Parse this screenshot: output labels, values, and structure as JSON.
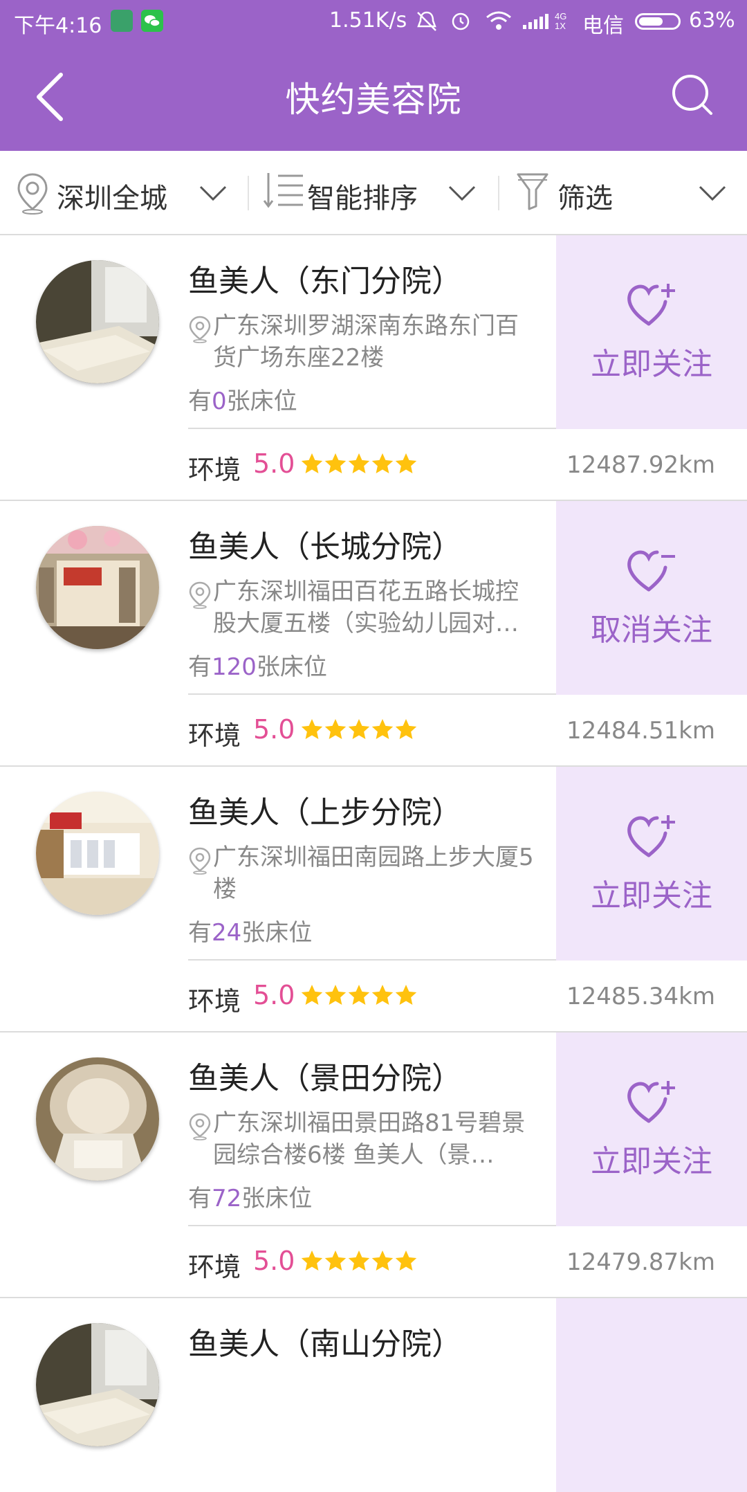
{
  "status_bar": {
    "time": "下午4:16",
    "net_speed": "1.51K/s",
    "carrier": "电信",
    "battery_pct": "63%",
    "battery_level": 0.63,
    "signal_label": "4G 1X"
  },
  "header": {
    "title": "快约美容院",
    "back_icon": "chevron-left-icon",
    "search_icon": "search-icon"
  },
  "filters": [
    {
      "label": "深圳全城",
      "icon": "location-pin-icon"
    },
    {
      "label": "智能排序",
      "icon": "sort-icon"
    },
    {
      "label": "筛选",
      "icon": "funnel-icon"
    }
  ],
  "colors": {
    "brand": "#9b63c8",
    "follow_bg": "#f1e6fa",
    "score": "#e34f95",
    "star": "#ffc20e"
  },
  "env_label": "环境",
  "beds_prefix": "有",
  "beds_suffix": "张床位",
  "salons": [
    {
      "name": "鱼美人（东门分院）",
      "address": "广东深圳罗湖深南东路东门百货广场东座22楼",
      "beds": "0",
      "follow_label": "立即关注",
      "follow_icon": "heart-plus-icon",
      "score": "5.0",
      "stars": 5,
      "distance": "12487.92km"
    },
    {
      "name": "鱼美人（长城分院）",
      "address": "广东深圳福田百花五路长城控股大厦五楼（实验幼儿园对…",
      "beds": "120",
      "follow_label": "取消关注",
      "follow_icon": "heart-minus-icon",
      "score": "5.0",
      "stars": 5,
      "distance": "12484.51km"
    },
    {
      "name": "鱼美人（上步分院）",
      "address": "广东深圳福田南园路上步大厦5楼",
      "beds": "24",
      "follow_label": "立即关注",
      "follow_icon": "heart-plus-icon",
      "score": "5.0",
      "stars": 5,
      "distance": "12485.34km"
    },
    {
      "name": "鱼美人（景田分院）",
      "address": "广东深圳福田景田路81号碧景园综合楼6楼 鱼美人（景…",
      "beds": "72",
      "follow_label": "立即关注",
      "follow_icon": "heart-plus-icon",
      "score": "5.0",
      "stars": 5,
      "distance": "12479.87km"
    }
  ],
  "partial_salon": {
    "name": "鱼美人（南山分院）"
  }
}
